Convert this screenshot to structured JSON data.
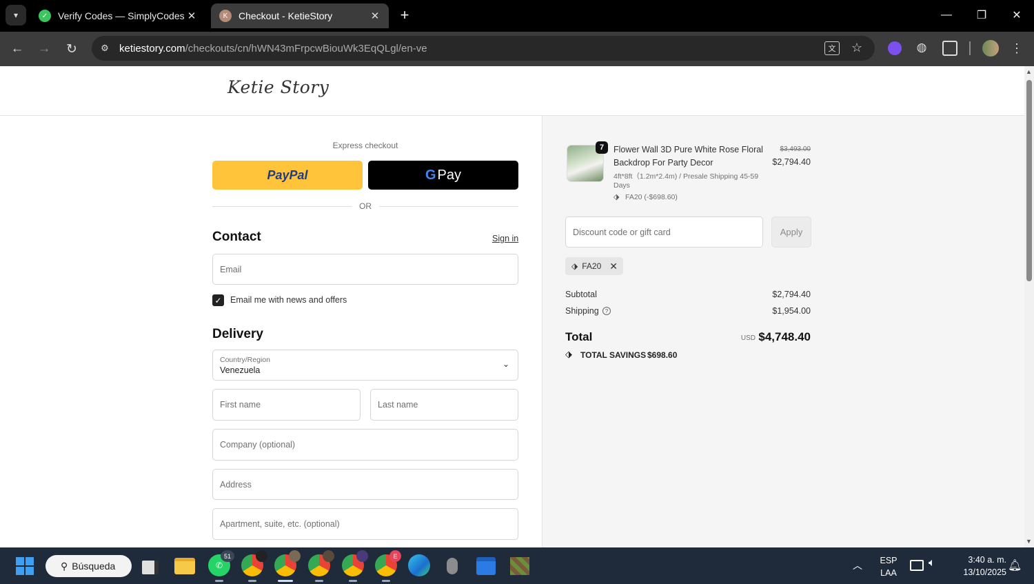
{
  "browser": {
    "tabs": [
      {
        "title": "Verify Codes — SimplyCodes",
        "active": false
      },
      {
        "title": "Checkout - KetieStory",
        "active": true
      }
    ],
    "url_host": "ketiestory.com",
    "url_path": "/checkouts/cn/hWN43mFrpcwBiouWk3EqQLgl/en-ve"
  },
  "store": {
    "logo_text": "Ketie Story"
  },
  "checkout": {
    "express_label": "Express checkout",
    "paypal_label": "PayPal",
    "gpay_g": "G",
    "gpay_label": "Pay",
    "or_label": "OR",
    "contact_heading": "Contact",
    "sign_in_label": "Sign in",
    "email_placeholder": "Email",
    "newsletter_label": "Email me with news and offers",
    "newsletter_checked": true,
    "delivery_heading": "Delivery",
    "country_label": "Country/Region",
    "country_value": "Venezuela",
    "first_name_placeholder": "First name",
    "last_name_placeholder": "Last name",
    "company_placeholder": "Company (optional)",
    "address_placeholder": "Address",
    "apartment_placeholder": "Apartment, suite, etc. (optional)"
  },
  "summary": {
    "item": {
      "quantity": "7",
      "name_line1": "Flower Wall 3D Pure White Rose Floral",
      "name_line2": "Backdrop For Party Decor",
      "variant_line1": "4ft*8ft（1.2m*2.4m) / Presale Shipping 45-59",
      "variant_line2": "Days",
      "discount": "FA20 (-$698.60)",
      "original_price": "$3,493.00",
      "price": "$2,794.40"
    },
    "discount_placeholder": "Discount code or gift card",
    "apply_label": "Apply",
    "applied_code": "FA20",
    "subtotal_label": "Subtotal",
    "subtotal_value": "$2,794.40",
    "shipping_label": "Shipping",
    "shipping_value": "$1,954.00",
    "total_label": "Total",
    "currency": "USD",
    "total_value": "$4,748.40",
    "savings_label": "TOTAL SAVINGS",
    "savings_value": "$698.60"
  },
  "taskbar": {
    "search_label": "Búsqueda",
    "whatsapp_badge": "51",
    "chrome2_badge": "E",
    "lang_line1": "ESP",
    "lang_line2": "LAA",
    "time": "3:40 a. m.",
    "date": "13/10/2025"
  },
  "colors": {
    "paypal_yellow": "#ffc439",
    "gpay_black": "#000000",
    "taskbar_bg": "#1f2b3a",
    "tab_bar_bg": "#000000",
    "toolbar_bg": "#3c3c3c"
  }
}
